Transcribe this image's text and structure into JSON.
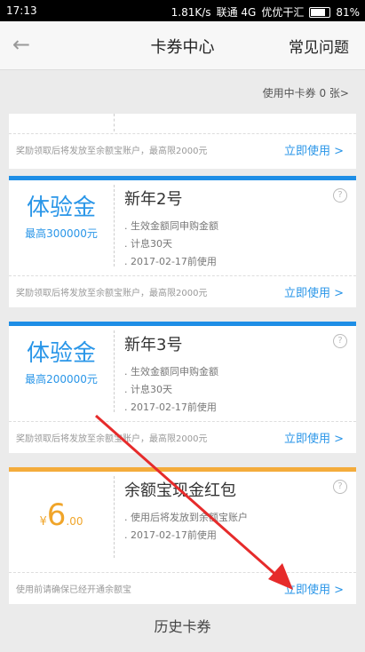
{
  "status": {
    "time": "17:13",
    "speed": "1.81K/s",
    "carrier": "联通 4G",
    "carrier2": "优优干汇",
    "battery": "81%"
  },
  "nav": {
    "title": "卡券中心",
    "faq": "常见问题",
    "back": "←"
  },
  "in_use": "使用中卡券 0 张>",
  "cards": [
    {
      "footer_note": "奖励领取后将发放至余额宝账户，最高限2000元",
      "use": "立即使用 >"
    },
    {
      "type_label": "体验金",
      "max": "最高300000元",
      "name": "新年2号",
      "lines": [
        "生效金额同申购金额",
        "计息30天",
        "2017-02-17前使用"
      ],
      "footer_note": "奖励领取后将发放至余额宝账户，最高限2000元",
      "use": "立即使用 >"
    },
    {
      "type_label": "体验金",
      "max": "最高200000元",
      "name": "新年3号",
      "lines": [
        "生效金额同申购金额",
        "计息30天",
        "2017-02-17前使用"
      ],
      "footer_note": "奖励领取后将发放至余额宝账户，最高限2000元",
      "use": "立即使用 >"
    },
    {
      "currency": "¥",
      "amount": "6",
      "cents": ".00",
      "name": "余额宝现金红包",
      "lines": [
        "使用后将发放到余额宝账户",
        "2017-02-17前使用"
      ],
      "footer_note": "使用前请确保已经开通余额宝",
      "use": "立即使用 >"
    }
  ],
  "history": "历史卡券",
  "colors": {
    "accent": "#2a96e8",
    "gold": "#f4ac3c",
    "arrow": "#e62b2b"
  }
}
